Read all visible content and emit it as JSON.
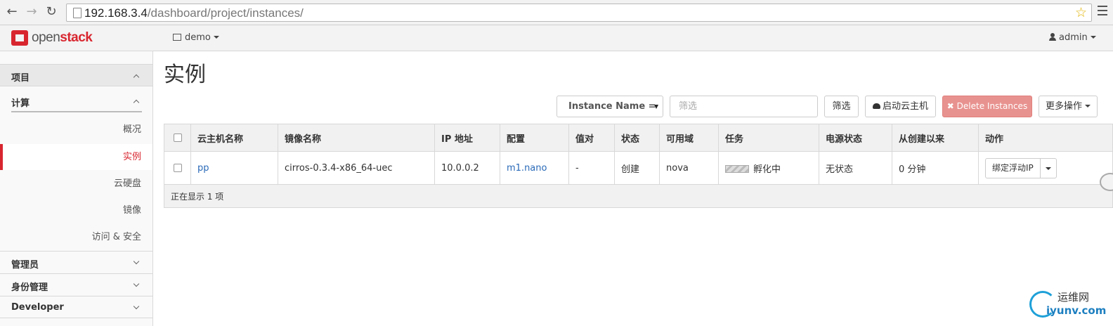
{
  "browser": {
    "url_host": "192.168.3.4",
    "url_path": "/dashboard/project/instances/"
  },
  "header": {
    "logo_text_a": "open",
    "logo_text_b": "stack",
    "project": "demo",
    "user": "admin"
  },
  "sidebar": {
    "panels": {
      "project": "项目",
      "compute": "计算",
      "admin": "管理员",
      "identity": "身份管理",
      "developer": "Developer"
    },
    "items": [
      "概况",
      "实例",
      "云硬盘",
      "镜像",
      "访问 & 安全"
    ]
  },
  "main": {
    "title": "实例",
    "filter_select": "Instance Name =",
    "filter_placeholder": "筛选",
    "filter_button": "筛选",
    "launch_button": "启动云主机",
    "delete_button": "Delete Instances",
    "more_button": "更多操作"
  },
  "table": {
    "headers": [
      "云主机名称",
      "镜像名称",
      "IP 地址",
      "配置",
      "值对",
      "状态",
      "可用域",
      "任务",
      "电源状态",
      "从创建以来",
      "动作"
    ],
    "rows": [
      {
        "name": "pp",
        "image": "cirros-0.3.4-x86_64-uec",
        "ip": "10.0.0.2",
        "flavor": "m1.nano",
        "keypair": "-",
        "status": "创建",
        "zone": "nova",
        "task": "孵化中",
        "power": "无状态",
        "age": "0 分钟",
        "action": "绑定浮动IP"
      }
    ],
    "footer": "正在显示 1 项"
  },
  "watermark": {
    "line1": "运维网",
    "line2": "iyunv.com"
  },
  "colors": {
    "brand_red": "#d8262f",
    "link_blue": "#2a6ab8",
    "danger_btn": "#e8928f"
  }
}
